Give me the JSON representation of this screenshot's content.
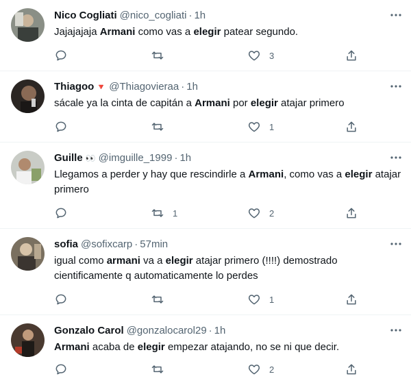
{
  "tweets": [
    {
      "name": "Nico Cogliati",
      "handle": "@nico_cogliati",
      "separator": "·",
      "time": "1h",
      "text_parts": [
        {
          "t": "Jajajajaja ",
          "b": false
        },
        {
          "t": "Armani",
          "b": true
        },
        {
          "t": " como vas a ",
          "b": false
        },
        {
          "t": "elegir",
          "b": true
        },
        {
          "t": " patear segundo.",
          "b": false
        }
      ],
      "reply_count": "",
      "retweet_count": "",
      "like_count": "3"
    },
    {
      "name": "Thiagoo",
      "name_emoji": "🔻",
      "handle": "@Thiagovieraa",
      "separator": "·",
      "time": "1h",
      "text_parts": [
        {
          "t": "sácale ya la cinta de capitán a ",
          "b": false
        },
        {
          "t": "Armani",
          "b": true
        },
        {
          "t": " por ",
          "b": false
        },
        {
          "t": "elegir",
          "b": true
        },
        {
          "t": " atajar primero",
          "b": false
        }
      ],
      "reply_count": "",
      "retweet_count": "",
      "like_count": "1"
    },
    {
      "name": "Guille",
      "name_emoji": "👀",
      "handle": "@imguille_1999",
      "separator": "·",
      "time": "1h",
      "text_parts": [
        {
          "t": "Llegamos a perder y hay que rescindirle a ",
          "b": false
        },
        {
          "t": "Armani",
          "b": true
        },
        {
          "t": ", como vas a ",
          "b": false
        },
        {
          "t": "elegir",
          "b": true
        },
        {
          "t": " atajar primero",
          "b": false
        }
      ],
      "reply_count": "",
      "retweet_count": "1",
      "like_count": "2"
    },
    {
      "name": "sofia",
      "handle": "@sofixcarp",
      "separator": "·",
      "time": "57min",
      "text_parts": [
        {
          "t": "igual como ",
          "b": false
        },
        {
          "t": "armani",
          "b": true
        },
        {
          "t": " va a ",
          "b": false
        },
        {
          "t": "elegir",
          "b": true
        },
        {
          "t": " atajar primero (!!!!) demostrado cientificamente q automaticamente lo perdes",
          "b": false
        }
      ],
      "reply_count": "",
      "retweet_count": "",
      "like_count": "1"
    },
    {
      "name": "Gonzalo Carol",
      "handle": "@gonzalocarol29",
      "separator": "·",
      "time": "1h",
      "text_parts": [
        {
          "t": "Armani",
          "b": true
        },
        {
          "t": " acaba de ",
          "b": false
        },
        {
          "t": "elegir",
          "b": true
        },
        {
          "t": " empezar atajando, no se ni que decir.",
          "b": false
        }
      ],
      "reply_count": "",
      "retweet_count": "",
      "like_count": "2"
    }
  ],
  "colors": {
    "text": "#0f1419",
    "secondary": "#536471",
    "divider": "#eff3f4"
  },
  "icons": {
    "reply": "reply-icon",
    "retweet": "retweet-icon",
    "like": "like-icon",
    "share": "share-icon",
    "more": "more-icon"
  }
}
